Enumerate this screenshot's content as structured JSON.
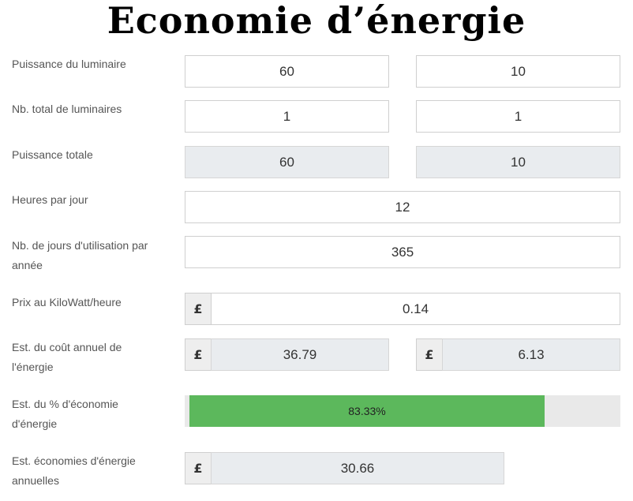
{
  "title": "Economie d’énergie",
  "currency_symbol": "£",
  "rows": {
    "fixture_power": {
      "label": "Puissance du luminaire",
      "value_a": "60",
      "value_b": "10"
    },
    "fixture_count": {
      "label": "Nb. total de luminaires",
      "value_a": "1",
      "value_b": "1"
    },
    "total_power": {
      "label": "Puissance totale",
      "value_a": "60",
      "value_b": "10"
    },
    "hours_per_day": {
      "label": "Heures par jour",
      "value": "12"
    },
    "days_per_year": {
      "label": "Nb. de jours d'utilisation par année",
      "value": "365"
    },
    "price_kwh": {
      "label": "Prix au KiloWatt/heure",
      "value": "0.14"
    },
    "annual_cost": {
      "label": "Est. du coût annuel de l'énergie",
      "value_a": "36.79",
      "value_b": "6.13"
    },
    "savings_percent": {
      "label": "Est. du % d'économie d'énergie",
      "value_text": "83.33%",
      "fraction": 0.8333,
      "bar_color": "#5cb85c"
    },
    "annual_savings": {
      "label": "Est. économies d'énergie annuelles",
      "value": "30.66"
    }
  }
}
